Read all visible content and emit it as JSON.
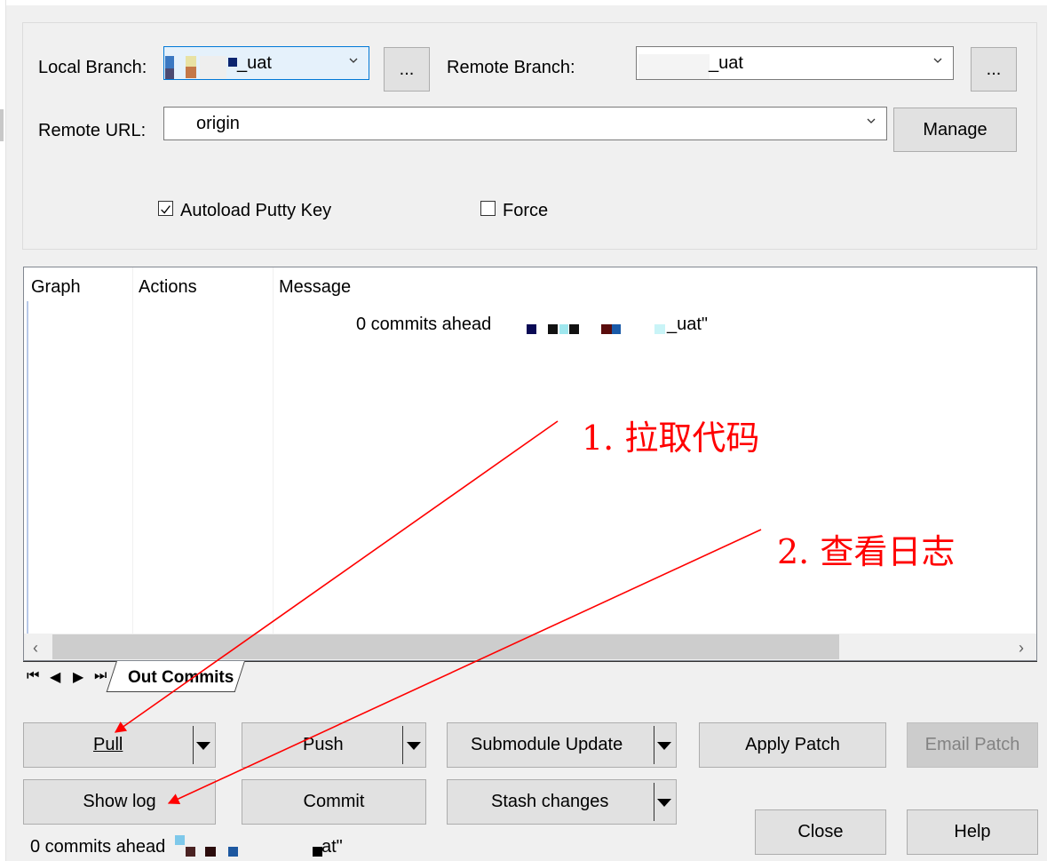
{
  "form": {
    "local_branch_label": "Local Branch:",
    "local_branch_value": "_uat",
    "remote_branch_label": "Remote Branch:",
    "remote_branch_value": "_uat",
    "browse_label": "...",
    "remote_url_label": "Remote URL:",
    "remote_url_value": "origin",
    "manage_label": "Manage",
    "autoload_label": "Autoload Putty Key",
    "autoload_checked": true,
    "force_label": "Force",
    "force_checked": false
  },
  "list": {
    "columns": [
      "Graph",
      "Actions",
      "Message"
    ],
    "row_message": "0 commits ahead",
    "row_message_suffix": "_uat\""
  },
  "tabs": {
    "active": "Out Commits"
  },
  "buttons": {
    "pull": "Pull",
    "push": "Push",
    "submodule_update": "Submodule Update",
    "apply_patch": "Apply Patch",
    "email_patch": "Email Patch",
    "show_log": "Show log",
    "commit": "Commit",
    "stash_changes": "Stash changes",
    "close": "Close",
    "help": "Help"
  },
  "status": {
    "text": "0 commits ahead",
    "suffix": "at\""
  },
  "annotations": {
    "step1": "1. 拉取代码",
    "step2": "2. 查看日志",
    "color": "#ff0000"
  }
}
